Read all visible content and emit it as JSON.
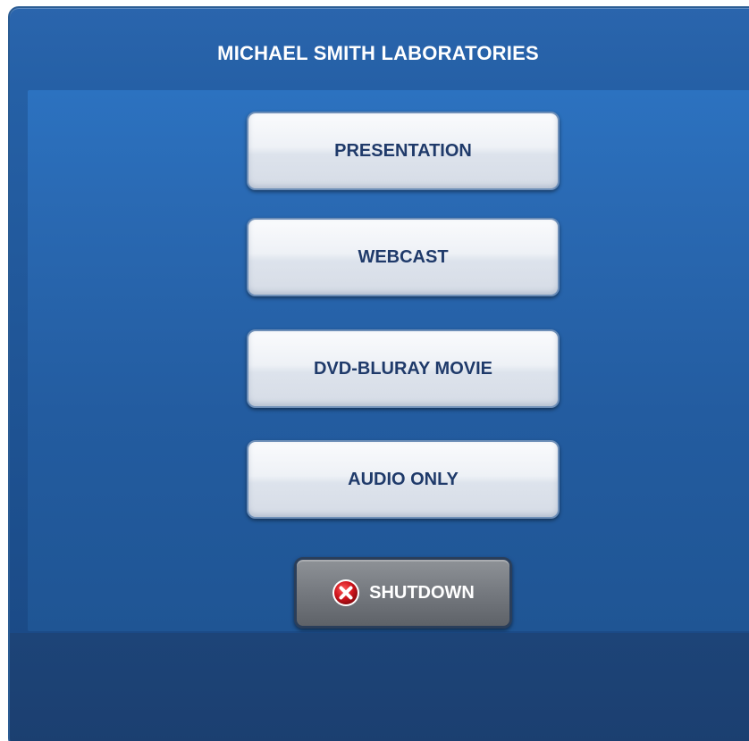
{
  "header": {
    "title": "MICHAEL SMITH LABORATORIES"
  },
  "menu": {
    "items": [
      {
        "label": "PRESENTATION"
      },
      {
        "label": "WEBCAST"
      },
      {
        "label": "DVD-BLURAY MOVIE"
      },
      {
        "label": "AUDIO ONLY"
      }
    ]
  },
  "shutdown": {
    "label": "SHUTDOWN",
    "icon": "close-circle-icon",
    "icon_color": "#c8102e"
  },
  "theme": {
    "background": "#2560a6",
    "panel": "#2968b1",
    "button_text": "#1f3a6a",
    "title_text": "#ffffff"
  }
}
